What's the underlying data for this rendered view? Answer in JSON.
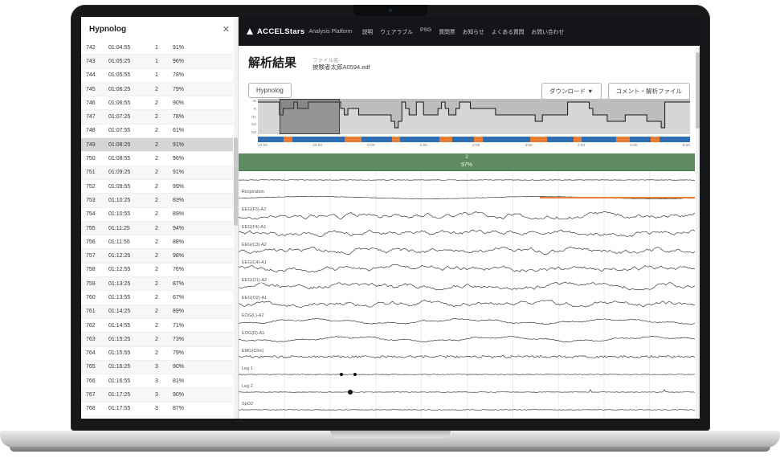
{
  "sidebar": {
    "title": "Hypnolog",
    "close_icon": "✕",
    "selected_row": 7,
    "rows": [
      [
        "742",
        "01:04:55",
        "1",
        "91%"
      ],
      [
        "743",
        "01:05:25",
        "1",
        "96%"
      ],
      [
        "744",
        "01:05:55",
        "1",
        "78%"
      ],
      [
        "745",
        "01:06:25",
        "2",
        "79%"
      ],
      [
        "746",
        "01:06:55",
        "2",
        "90%"
      ],
      [
        "747",
        "01:07:25",
        "2",
        "78%"
      ],
      [
        "748",
        "01:07:55",
        "2",
        "61%"
      ],
      [
        "749",
        "01:08:25",
        "2",
        "91%"
      ],
      [
        "750",
        "01:08:55",
        "2",
        "96%"
      ],
      [
        "751",
        "01:09:25",
        "2",
        "91%"
      ],
      [
        "752",
        "01:09:55",
        "2",
        "99%"
      ],
      [
        "753",
        "01:10:25",
        "2",
        "83%"
      ],
      [
        "754",
        "01:10:55",
        "2",
        "89%"
      ],
      [
        "755",
        "01:11:25",
        "2",
        "94%"
      ],
      [
        "756",
        "01:11:55",
        "2",
        "88%"
      ],
      [
        "757",
        "01:12:25",
        "2",
        "98%"
      ],
      [
        "758",
        "01:12:55",
        "2",
        "76%"
      ],
      [
        "759",
        "01:13:25",
        "2",
        "87%"
      ],
      [
        "760",
        "01:13:55",
        "2",
        "67%"
      ],
      [
        "761",
        "01:14:25",
        "2",
        "89%"
      ],
      [
        "762",
        "01:14:55",
        "2",
        "71%"
      ],
      [
        "763",
        "01:15:25",
        "2",
        "73%"
      ],
      [
        "764",
        "01:15:55",
        "2",
        "79%"
      ],
      [
        "765",
        "01:16:25",
        "3",
        "90%"
      ],
      [
        "766",
        "01:16:55",
        "3",
        "81%"
      ],
      [
        "767",
        "01:17:25",
        "3",
        "90%"
      ],
      [
        "768",
        "01:17:55",
        "3",
        "87%"
      ]
    ]
  },
  "nav": {
    "logo": "ACCELStars",
    "platform": "Analysis Platform",
    "items": [
      "説明",
      "ウェアラブル",
      "PSG",
      "質問票",
      "お知らせ",
      "よくある質問",
      "お問い合わせ"
    ]
  },
  "header": {
    "title": "解析結果",
    "file_label": "ファイル名",
    "file_name": "被験者太郎A0594.edf"
  },
  "toolbar": {
    "hypnolog": "Hypnolog",
    "download": "ダウンロード ▼",
    "comment": "コメント・解析ファイル"
  },
  "overview": {
    "stage_labels": [
      "W",
      "R",
      "N1",
      "N2",
      "N3"
    ],
    "time_labels": [
      "22:00",
      "23:00",
      "0:00",
      "1:00",
      "2:00",
      "3:00",
      "4:00",
      "5:00",
      "6:00"
    ],
    "selection": {
      "left_pct": 5,
      "width_pct": 14
    },
    "strip_segments": [
      {
        "color": "#2f6db5",
        "width": 6
      },
      {
        "color": "#e87c33",
        "width": 2
      },
      {
        "color": "#2f6db5",
        "width": 12
      },
      {
        "color": "#e87c33",
        "width": 4
      },
      {
        "color": "#2f6db5",
        "width": 7
      },
      {
        "color": "#e87c33",
        "width": 2
      },
      {
        "color": "#2f6db5",
        "width": 9
      },
      {
        "color": "#e87c33",
        "width": 3
      },
      {
        "color": "#2f6db5",
        "width": 5
      },
      {
        "color": "#e87c33",
        "width": 2
      },
      {
        "color": "#2f6db5",
        "width": 11
      },
      {
        "color": "#e87c33",
        "width": 4
      },
      {
        "color": "#2f6db5",
        "width": 6
      },
      {
        "color": "#e87c33",
        "width": 2
      },
      {
        "color": "#2f6db5",
        "width": 8
      },
      {
        "color": "#e87c33",
        "width": 3
      },
      {
        "color": "#2f6db5",
        "width": 5
      },
      {
        "color": "#e87c33",
        "width": 2
      },
      {
        "color": "#2f6db5",
        "width": 7
      }
    ]
  },
  "epoch": {
    "stage": "2",
    "confidence": "97%"
  },
  "signals": {
    "channels": [
      {
        "label": "",
        "type": "flat"
      },
      {
        "label": "Respiration",
        "type": "resp",
        "event": {
          "start_pct": 66,
          "width_pct": 34,
          "color": "#e8823b"
        }
      },
      {
        "label": "EEG(F3)-A2",
        "type": "eeg"
      },
      {
        "label": "EEG(F4)-A1",
        "type": "eeg"
      },
      {
        "label": "EEG(C3)-A2",
        "type": "eeg"
      },
      {
        "label": "EEG(C4)-A1",
        "type": "eeg"
      },
      {
        "label": "EEG(O1)-A2",
        "type": "eeg"
      },
      {
        "label": "EEG(O2)-A1",
        "type": "eeg"
      },
      {
        "label": "EOG(L)-A2",
        "type": "eog"
      },
      {
        "label": "EOG(R)-A1",
        "type": "eog"
      },
      {
        "label": "EMG(Chin)",
        "type": "emg"
      },
      {
        "label": "Leg 1",
        "type": "leg"
      },
      {
        "label": "Leg 2",
        "type": "leg"
      },
      {
        "label": "SpO2",
        "type": "flat"
      }
    ],
    "event_dots": [
      {
        "channel": 11,
        "x_pct": 22.5,
        "size": 4
      },
      {
        "channel": 11,
        "x_pct": 25.5,
        "size": 4
      },
      {
        "channel": 12,
        "x_pct": 24.5,
        "size": 6
      }
    ]
  }
}
